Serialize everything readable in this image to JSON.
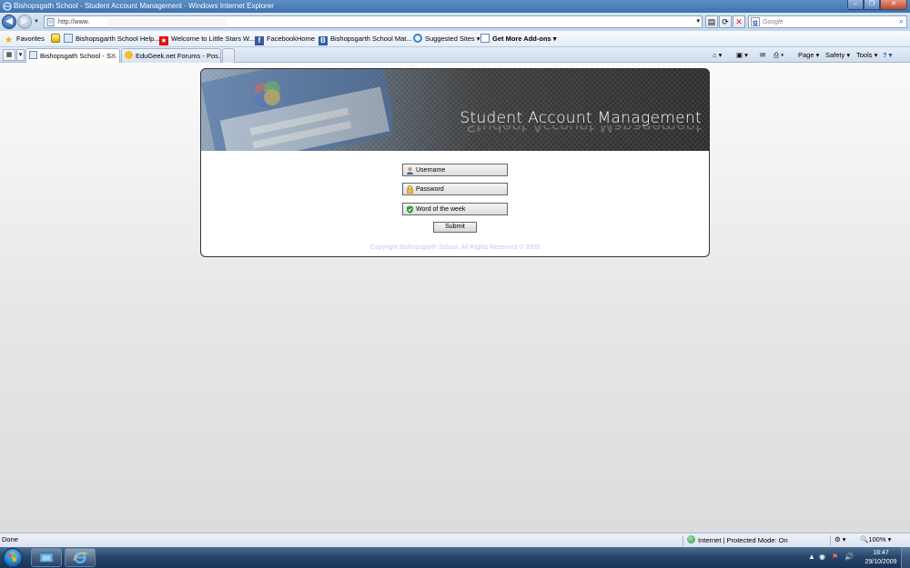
{
  "window": {
    "title": "Bishopsgath School - Student Account Management - Windows Internet Explorer",
    "minimize": "–",
    "maximize": "❐",
    "close": "✕"
  },
  "address_bar": {
    "url": "http://www.",
    "search_placeholder": "Google"
  },
  "favorites_bar": {
    "favorites_label": "Favorites",
    "items": [
      "Bishopsgarth School Help...",
      "Welcome to Little Stars W...",
      "Facebook",
      "Home",
      "Bishopsgarth School Mat...",
      "Suggested Sites ▾",
      "Get More Add-ons ▾"
    ]
  },
  "tabs": [
    {
      "label": "Bishopsgath School - S..."
    },
    {
      "label": "EduGeek.net Forums - Pos..."
    }
  ],
  "command_bar": {
    "page": "Page ▾",
    "safety": "Safety ▾",
    "tools": "Tools ▾",
    "help": "? ▾"
  },
  "page": {
    "banner_title": "Student Account Management",
    "username_placeholder": "Username",
    "password_placeholder": "Password",
    "word_placeholder": "Word of the week",
    "submit_label": "Submit",
    "copyright": "Copyright Bishopsgarth School, All Rights Reserved © 2009"
  },
  "status_bar": {
    "status": "Done",
    "zone": "Internet | Protected Mode: On",
    "zoom": "100%"
  },
  "taskbar": {
    "time": "18:47",
    "date": "29/10/2009"
  },
  "colors": {
    "banner_bg": "#2a2a2a",
    "copyright_text": "#c9c4f0",
    "taskbar": "#27466c"
  }
}
